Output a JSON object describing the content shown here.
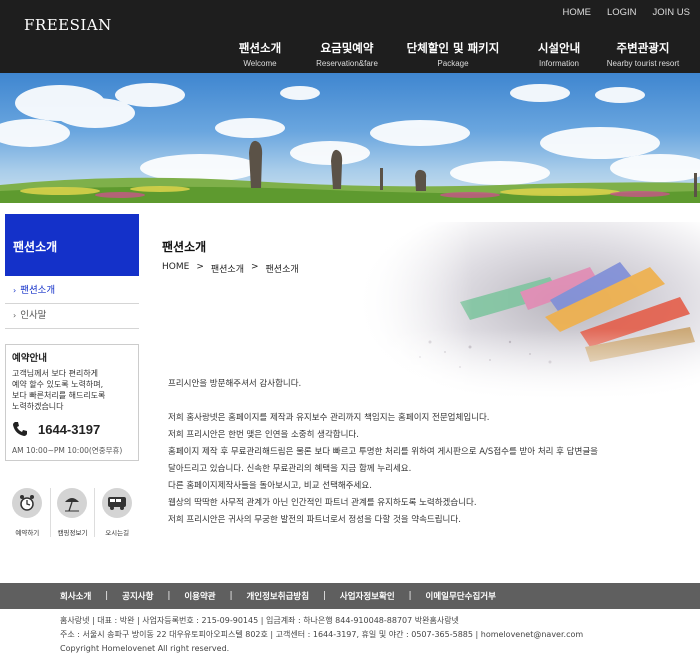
{
  "header": {
    "logo": "FREESIAN",
    "util": [
      "HOME",
      "LOGIN",
      "JOIN US"
    ],
    "nav": [
      {
        "ko": "팬션소개",
        "en": "Welcome"
      },
      {
        "ko": "요금및예약",
        "en": "Reservation&fare"
      },
      {
        "ko": "단체할인 및 패키지",
        "en": "Package"
      },
      {
        "ko": "시설안내",
        "en": "Information"
      },
      {
        "ko": "주변관광지",
        "en": "Nearby tourist resort"
      }
    ]
  },
  "sidebar": {
    "title": "팬션소개",
    "items": [
      {
        "label": "팬션소개",
        "active": true
      },
      {
        "label": "인사말",
        "active": false
      }
    ],
    "reservation": {
      "title": "예약안내",
      "desc": [
        "고객님께서 보다 편리하게",
        "예약 할수 있도록 노력하며,",
        "보다 빠른처리를 해드리도록",
        "노력하겠습니다"
      ],
      "phone": "1644-3197",
      "hours": "AM 10:00~PM 10:00(연중무휴)"
    },
    "quick": [
      {
        "label": "예약하기",
        "icon": "alarm-clock-icon"
      },
      {
        "label": "캠핑정보기",
        "icon": "parasol-icon"
      },
      {
        "label": "오시는길",
        "icon": "bus-icon"
      }
    ]
  },
  "content": {
    "title": "팬션소개",
    "breadcrumb": [
      "HOME",
      "팬션소개",
      "팬션소개"
    ],
    "paragraphs": [
      "프리시안을 방문해주셔서 감사합니다.",
      "",
      "저희 홈사랑넷은 홈페이지를 제작과 유지보수 관리까지 책임지는 홈페이지 전문업체입니다.",
      "저희 프리시안은 한번 맺은 인연을 소중히 생각합니다.",
      "홈페이지 제작 후 무료관리해드림은 물론 보다 빠르고 투명한 처리를 위하여 게시판으로 A/S접수를 받아 처리 후 답변글을",
      "달아드리고 있습니다. 신속한 무료관리의 혜택을 지금 함께 누리세요.",
      "다른 홈페이지제작사들을 돌아보시고, 비교 선택해주세요.",
      "웹상의 딱딱한 사무적 관계가 아닌 인간적인 파트너 관계를 유지하도록 노력하겠습니다.",
      "저희 프리시안은 귀사의 무궁한 발전의 파트너로서 정성을 다할 것을 약속드립니다."
    ]
  },
  "footer": {
    "links": [
      "회사소개",
      "공지사항",
      "이용약관",
      "개인정보취급방침",
      "사업자정보확인",
      "이메일무단수집거부"
    ],
    "info": [
      "홈사랑넷  |  대표 : 박완  |  사업자등록번호 : 215-09-90145  |  입금계좌 : 하나은행 844-910048-88707 박완홈사랑넷",
      "주소 : 서울시 송파구 방이동 22 대우유토피아오피스텔 802호  |  고객센터 : 1644-3197, 휴일 및 야간 : 0507-365-5885  |  homelovenet@naver.com",
      "Copyright Homelovenet All right reserved."
    ]
  },
  "colors": {
    "header_bg": "#1e1e1e",
    "accent": "#1431c9",
    "footer_bg": "#5f5f5f"
  }
}
